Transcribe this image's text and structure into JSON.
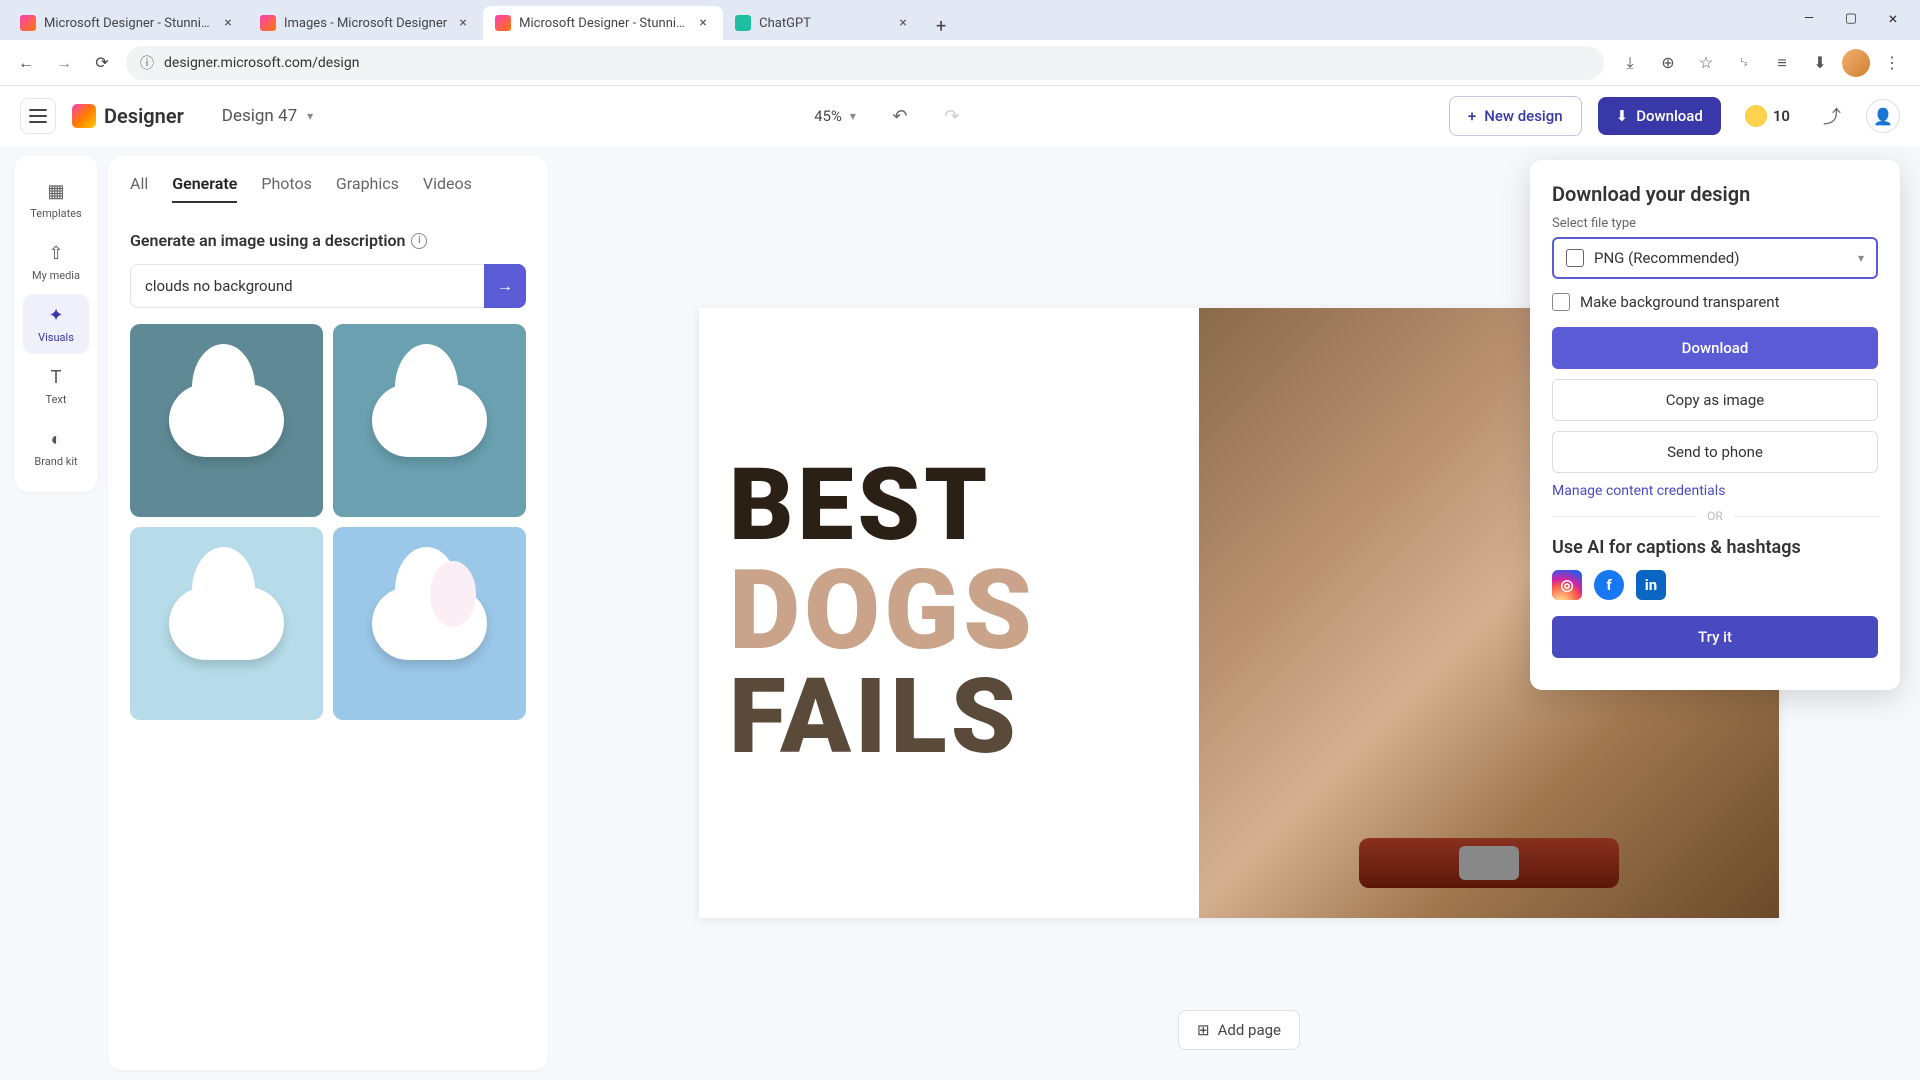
{
  "browser": {
    "tabs": [
      {
        "title": "Microsoft Designer - Stunning",
        "favicon": "fav-d",
        "active": false
      },
      {
        "title": "Images - Microsoft Designer",
        "favicon": "fav-d",
        "active": false
      },
      {
        "title": "Microsoft Designer - Stunning",
        "favicon": "fav-d",
        "active": true
      },
      {
        "title": "ChatGPT",
        "favicon": "fav-c",
        "active": false
      }
    ],
    "url": "designer.microsoft.com/design"
  },
  "header": {
    "logo_text": "Designer",
    "design_name": "Design 47",
    "zoom": "45%",
    "new_design": "New design",
    "download": "Download",
    "credits": "10"
  },
  "rail": {
    "items": [
      {
        "label": "Templates",
        "icon": "▦"
      },
      {
        "label": "My media",
        "icon": "⇧"
      },
      {
        "label": "Visuals",
        "icon": "✦",
        "active": true
      },
      {
        "label": "Text",
        "icon": "T"
      },
      {
        "label": "Brand kit",
        "icon": "◐"
      }
    ]
  },
  "panel": {
    "tabs": [
      "All",
      "Generate",
      "Photos",
      "Graphics",
      "Videos"
    ],
    "active_tab": "Generate",
    "gen_title": "Generate an image using a description",
    "prompt_value": "clouds no background"
  },
  "canvas": {
    "words": [
      "BEST",
      "DOGS",
      "FAILS"
    ],
    "add_page": "Add page"
  },
  "popover": {
    "title": "Download your design",
    "file_type_label": "Select file type",
    "file_type_value": "PNG (Recommended)",
    "transparent_label": "Make background transparent",
    "download_btn": "Download",
    "copy_btn": "Copy as image",
    "send_btn": "Send to phone",
    "manage_link": "Manage content credentials",
    "or": "OR",
    "ai_title": "Use AI for captions & hashtags",
    "try_btn": "Try it"
  }
}
